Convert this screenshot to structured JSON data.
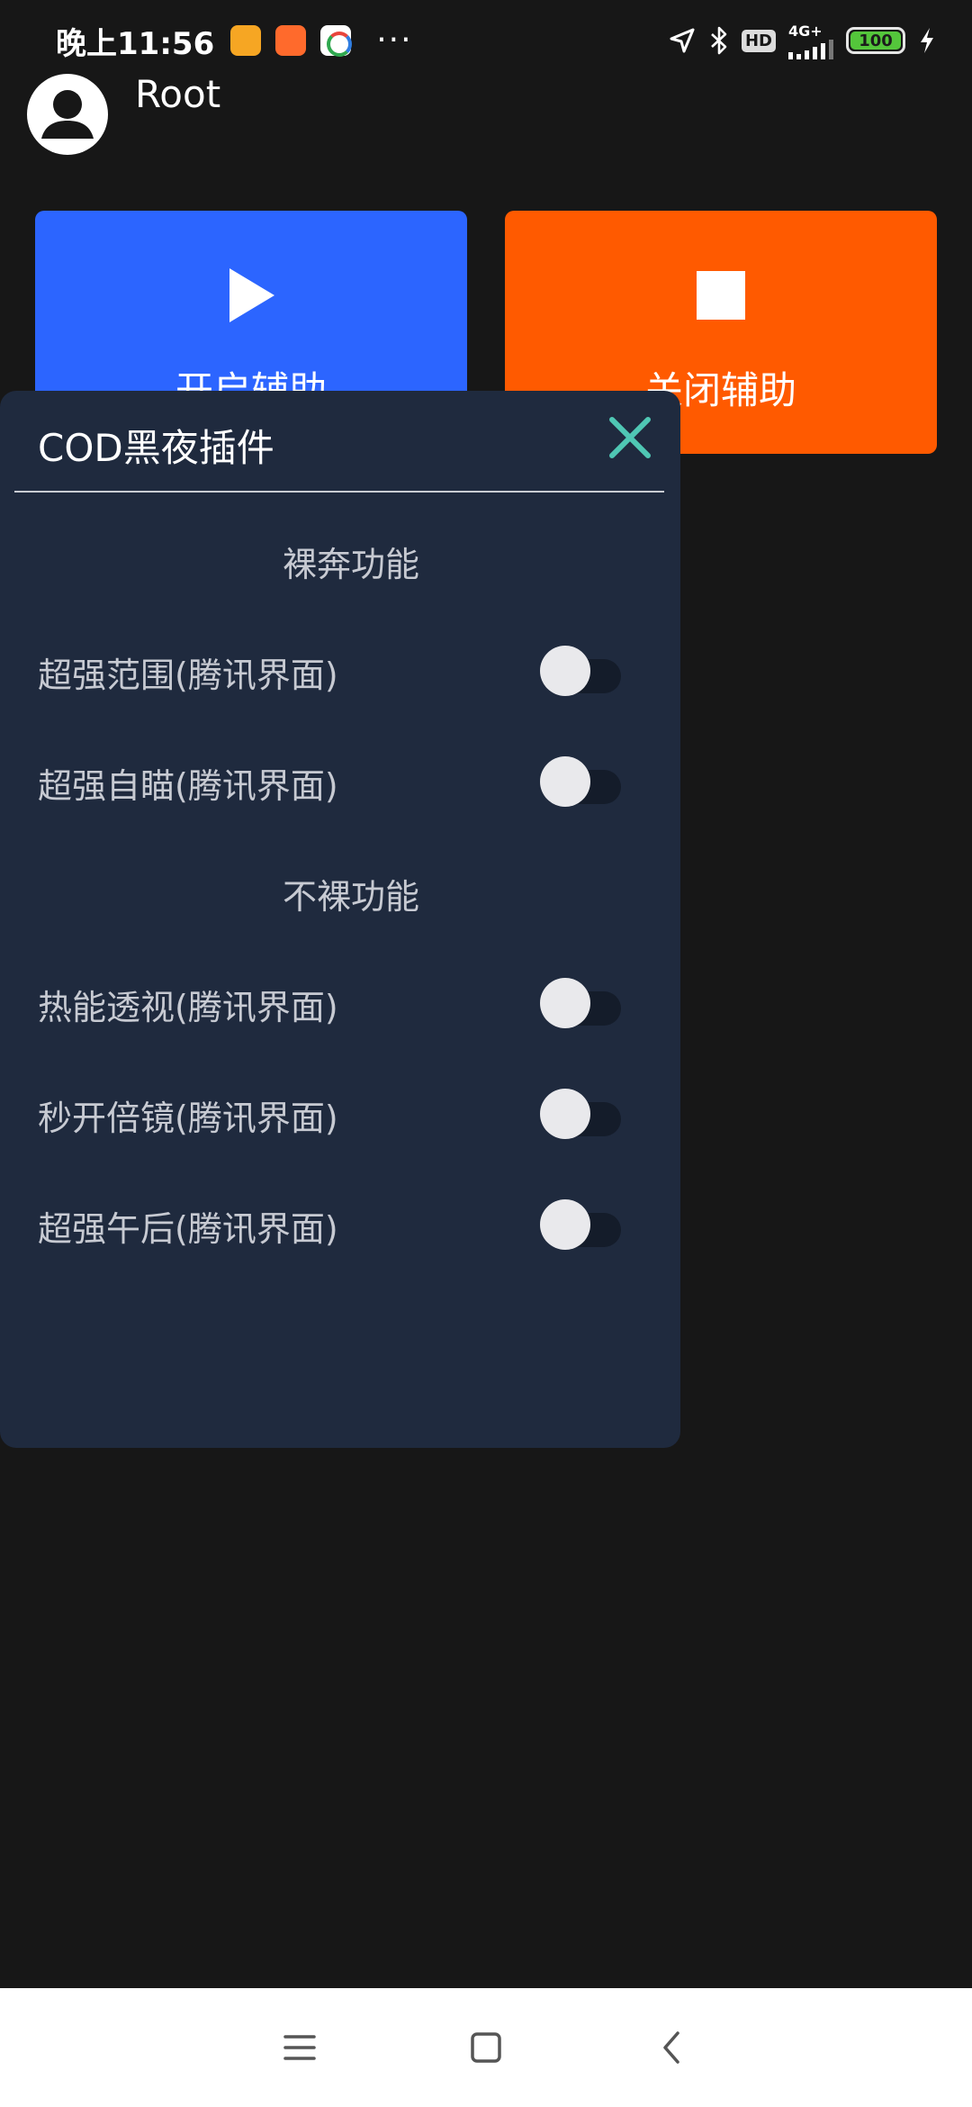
{
  "status_bar": {
    "time": "晚上11:56",
    "more": "···",
    "hd": "HD",
    "network": "4G+",
    "battery": "100"
  },
  "header": {
    "user_name": "Root"
  },
  "actions": {
    "start_label": "开启辅助",
    "stop_label": "关闭辅助",
    "start_color": "#2c65ff",
    "stop_color": "#ff5a00"
  },
  "panel": {
    "title": "COD黑夜插件",
    "accent": "#4fc7b4",
    "sections": [
      {
        "title": "裸奔功能",
        "options": [
          {
            "label": "超强范围(腾讯界面)",
            "enabled": false
          },
          {
            "label": "超强自瞄(腾讯界面)",
            "enabled": false
          }
        ]
      },
      {
        "title": "不裸功能",
        "options": [
          {
            "label": "热能透视(腾讯界面)",
            "enabled": false
          },
          {
            "label": "秒开倍镜(腾讯界面)",
            "enabled": false
          },
          {
            "label": "超强午后(腾讯界面)",
            "enabled": false
          }
        ]
      }
    ]
  },
  "nav": {
    "icons": [
      "menu-icon",
      "home-icon",
      "back-icon"
    ]
  }
}
